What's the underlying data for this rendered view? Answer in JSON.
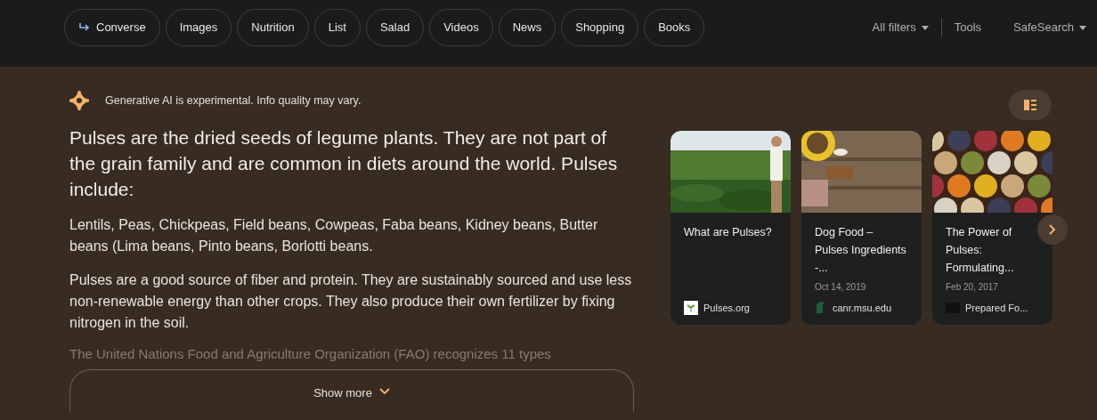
{
  "filter_chips": [
    {
      "label": "Converse",
      "kind": "converse"
    },
    {
      "label": "Images",
      "kind": "plain"
    },
    {
      "label": "Nutrition",
      "kind": "plain"
    },
    {
      "label": "List",
      "kind": "plain"
    },
    {
      "label": "Salad",
      "kind": "plain"
    },
    {
      "label": "Videos",
      "kind": "plain"
    },
    {
      "label": "News",
      "kind": "plain"
    },
    {
      "label": "Shopping",
      "kind": "plain"
    },
    {
      "label": "Books",
      "kind": "plain"
    }
  ],
  "toolbar": {
    "all_filters": "All filters",
    "tools": "Tools",
    "safe_search": "SafeSearch"
  },
  "ai_overview": {
    "notice": "Generative AI is experimental. Info quality may vary.",
    "headline": "Pulses are the dried seeds of legume plants. They are not part of the grain family and are common in diets around the world. Pulses include:",
    "paragraphs": [
      "Lentils, Peas, Chickpeas, Field beans, Cowpeas, Faba beans, Kidney beans, Butter beans (Lima beans, Pinto beans, Borlotti beans.",
      "Pulses are a good source of fiber and protein. They are sustainably sourced and use less non-renewable energy than other crops. They also produce their own fertilizer by fixing nitrogen in the soil."
    ],
    "faded_line": "The United Nations Food and Agriculture Organization (FAO) recognizes 11 types",
    "show_more": "Show more"
  },
  "source_cards": [
    {
      "title": "What are Pulses?",
      "source": "Pulses.org",
      "kind": "picture"
    },
    {
      "title": "Dog Food – Pulses Ingredients -...",
      "date": "Oct 14, 2019",
      "source": "canr.msu.edu",
      "kind": "picture"
    },
    {
      "title": "The Power of Pulses: Formulating...",
      "date": "Feb 20, 2017",
      "source": "Prepared Fo...",
      "kind": "picture"
    }
  ]
}
